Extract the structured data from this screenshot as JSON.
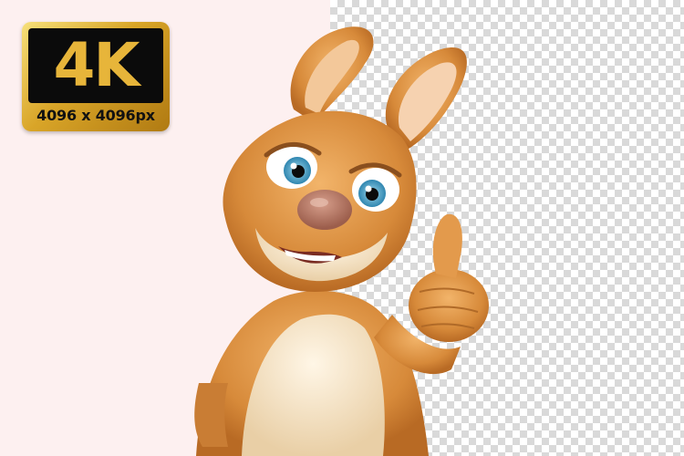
{
  "badge": {
    "main": "4K",
    "resolution": "4096 x 4096px"
  },
  "colors": {
    "left_background": "#fdf0f0",
    "checker_light": "#ffffff",
    "checker_dark": "#d9d9d9",
    "badge_gold": "#d9a528",
    "badge_black": "#0b0b0b",
    "fur_orange": "#d78a3a",
    "fur_cream": "#f5e3c4",
    "eye_blue": "#4aa3c8"
  },
  "icons": [
    "cartoon-kangaroo-thumbs-up"
  ]
}
